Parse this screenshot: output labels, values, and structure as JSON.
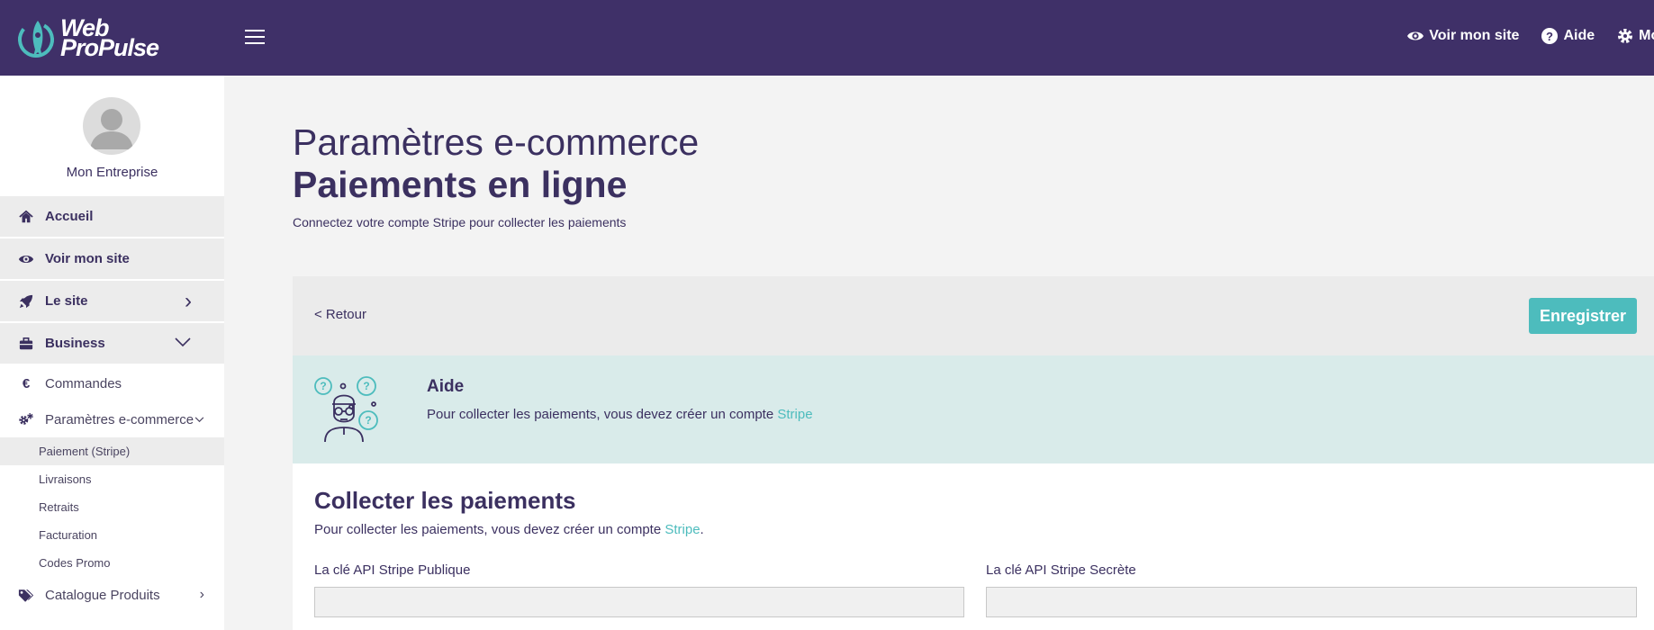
{
  "topbar": {
    "logo_line1": "Web",
    "logo_line2": "ProPulse",
    "links": [
      {
        "label": "Voir mon site",
        "icon": "eye-icon"
      },
      {
        "label": "Aide",
        "icon": "help-circle-icon"
      },
      {
        "label": "Mon",
        "icon": "gear-icon"
      }
    ]
  },
  "sidebar": {
    "company": "Mon Entreprise",
    "items": [
      {
        "label": "Accueil",
        "icon": "home-icon"
      },
      {
        "label": "Voir mon site",
        "icon": "eye-icon"
      },
      {
        "label": "Le site",
        "icon": "rocket-icon",
        "chevron": "›"
      },
      {
        "label": "Business",
        "icon": "briefcase-icon",
        "chevron": "⌄"
      }
    ],
    "business_sub": [
      {
        "label": "Commandes",
        "icon": "euro-icon"
      },
      {
        "label": "Paramètres e-commerce",
        "icon": "gears-icon",
        "chevron": "⌄"
      }
    ],
    "ecommerce_sub": [
      "Paiement (Stripe)",
      "Livraisons",
      "Retraits",
      "Facturation",
      "Codes Promo"
    ],
    "catalogue": {
      "label": "Catalogue Produits",
      "icon": "tags-icon",
      "chevron": "›"
    }
  },
  "main": {
    "subtitle": "Paramètres e-commerce",
    "title": "Paiements en ligne",
    "description": "Connectez votre compte Stripe pour collecter les paiements",
    "back_label": "< Retour",
    "save_label": "Enregistrer",
    "help": {
      "title": "Aide",
      "text": "Pour collecter les paiements, vous devez créer un compte ",
      "link": "Stripe"
    },
    "collect": {
      "title": "Collecter les paiements",
      "text": "Pour collecter les paiements, vous devez créer un compte ",
      "link": "Stripe",
      "text_end": "."
    },
    "fields": {
      "public_label": "La clé API Stripe Publique",
      "public_value": "",
      "secret_label": "La clé API Stripe Secrète",
      "secret_value": ""
    }
  },
  "colors": {
    "topbar": "#3f3068",
    "accent": "#4dbcbd",
    "text": "#3b3060",
    "help_bg": "#d9ebea"
  }
}
